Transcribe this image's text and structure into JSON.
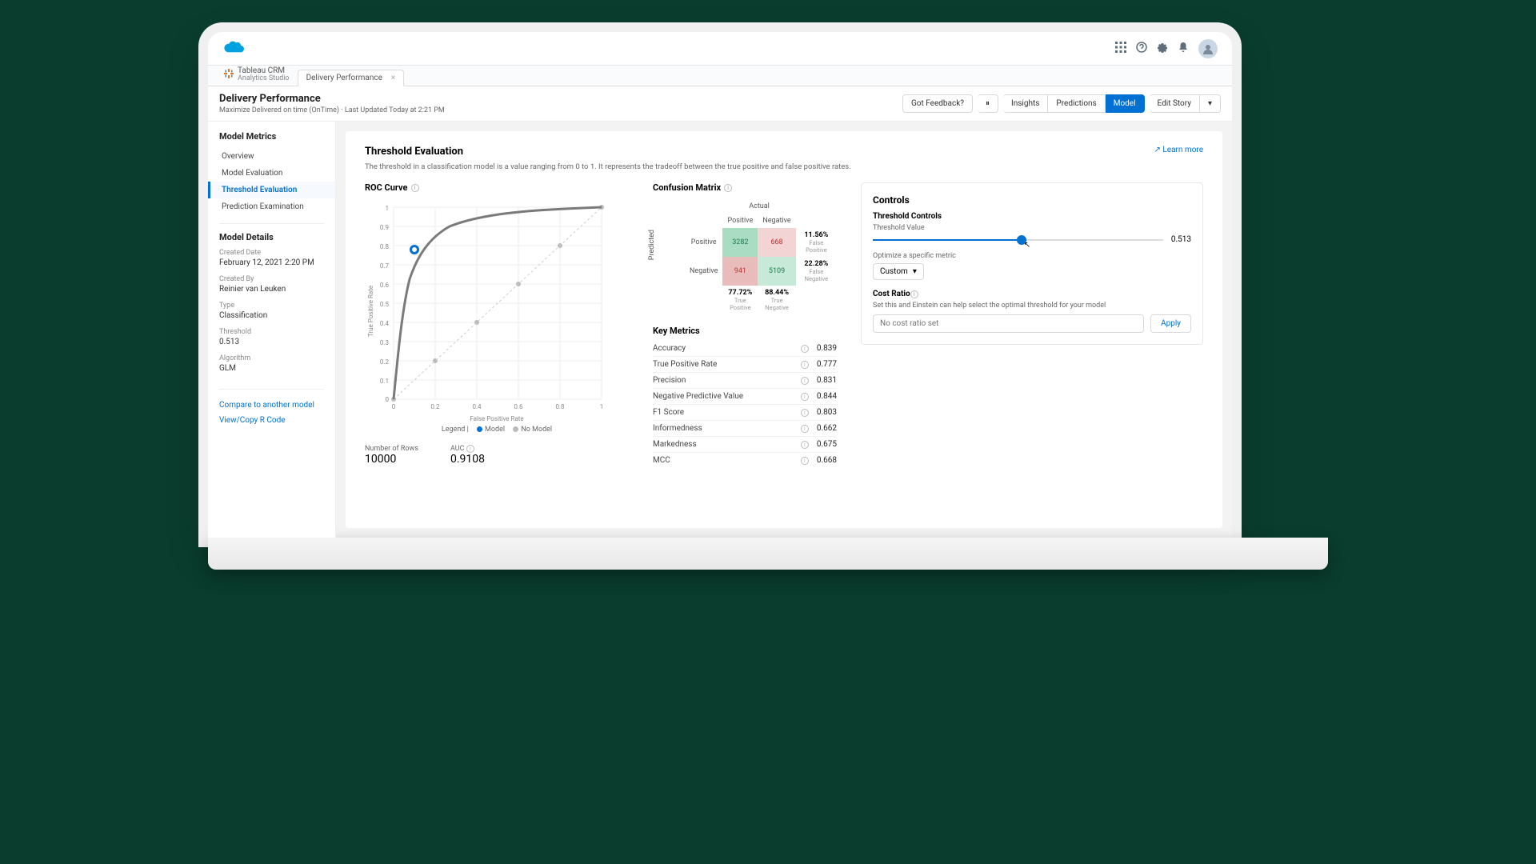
{
  "top": {
    "app_name": "Tableau CRM",
    "app_sub": "Analytics Studio",
    "tab": "Delivery Performance"
  },
  "header": {
    "title": "Delivery Performance",
    "subtitle": "Maximize Delivered on time (OnTime) · Last Updated Today at 2:21 PM",
    "feedback": "Got Feedback?",
    "insights": "Insights",
    "predictions": "Predictions",
    "model": "Model",
    "edit": "Edit Story"
  },
  "sidebar": {
    "heading": "Model Metrics",
    "items": [
      "Overview",
      "Model Evaluation",
      "Threshold Evaluation",
      "Prediction Examination"
    ],
    "details_heading": "Model Details",
    "created_date_label": "Created Date",
    "created_date": "February 12, 2021 2:20 PM",
    "created_by_label": "Created By",
    "created_by": "Reinier van Leuken",
    "type_label": "Type",
    "type": "Classification",
    "threshold_label": "Threshold",
    "threshold": "0.513",
    "algorithm_label": "Algorithm",
    "algorithm": "GLM",
    "link_compare": "Compare to another model",
    "link_rcode": "View/Copy R Code"
  },
  "page": {
    "title": "Threshold Evaluation",
    "desc": "The threshold in a classification model is a value ranging from 0 to 1. It represents the tradeoff between the true positive and false positive rates.",
    "learn_more": "Learn more",
    "roc_title": "ROC Curve",
    "xlabel": "False Positive Rate",
    "ylabel": "True Positive Rate",
    "legend": "Legend",
    "legend_model": "Model",
    "legend_nomodel": "No Model",
    "rows_label": "Number of Rows",
    "rows_value": "10000",
    "auc_label": "AUC",
    "auc_value": "0.9108",
    "cm_title": "Confusion Matrix",
    "cm_actual": "Actual",
    "cm_predicted": "Predicted",
    "cm_pos": "Positive",
    "cm_neg": "Negative",
    "cm": {
      "tp": "3282",
      "fn": "668",
      "fp": "941",
      "tn": "5109",
      "fp_pct": "11.56%",
      "fp_lbl": "False Positive",
      "fn_pct": "22.28%",
      "fn_lbl": "False Negative",
      "tp_pct": "77.72%",
      "tp_lbl": "True Positive",
      "tn_pct": "88.44%",
      "tn_lbl": "True Negative"
    },
    "km_title": "Key Metrics",
    "km": [
      {
        "k": "Accuracy",
        "v": "0.839"
      },
      {
        "k": "True Positive Rate",
        "v": "0.777"
      },
      {
        "k": "Precision",
        "v": "0.831"
      },
      {
        "k": "Negative Predictive Value",
        "v": "0.844"
      },
      {
        "k": "F1 Score",
        "v": "0.803"
      },
      {
        "k": "Informedness",
        "v": "0.662"
      },
      {
        "k": "Markedness",
        "v": "0.675"
      },
      {
        "k": "MCC",
        "v": "0.668"
      }
    ]
  },
  "controls": {
    "heading": "Controls",
    "tc_heading": "Threshold Controls",
    "tv_label": "Threshold Value",
    "tv_value": "0.513",
    "optimize_label": "Optimize a specific metric",
    "optimize_value": "Custom",
    "cost_heading": "Cost Ratio",
    "cost_desc": "Set this and Einstein can help select the optimal threshold for your model",
    "cost_placeholder": "No cost ratio set",
    "apply": "Apply"
  },
  "chart_data": {
    "type": "line",
    "title": "ROC Curve",
    "xlabel": "False Positive Rate",
    "ylabel": "True Positive Rate",
    "xlim": [
      0,
      1
    ],
    "ylim": [
      0,
      1
    ],
    "series": [
      {
        "name": "Model",
        "points": [
          [
            0,
            0
          ],
          [
            0.02,
            0.3
          ],
          [
            0.05,
            0.55
          ],
          [
            0.08,
            0.7
          ],
          [
            0.1,
            0.78
          ],
          [
            0.15,
            0.86
          ],
          [
            0.2,
            0.9
          ],
          [
            0.3,
            0.94
          ],
          [
            0.4,
            0.965
          ],
          [
            0.5,
            0.975
          ],
          [
            0.6,
            0.985
          ],
          [
            0.7,
            0.99
          ],
          [
            0.8,
            0.995
          ],
          [
            0.9,
            0.998
          ],
          [
            1.0,
            1.0
          ]
        ]
      },
      {
        "name": "No Model",
        "points": [
          [
            0,
            0
          ],
          [
            1,
            1
          ]
        ]
      }
    ],
    "threshold_point": [
      0.1,
      0.78
    ],
    "auc": 0.9108,
    "n_rows": 10000
  }
}
